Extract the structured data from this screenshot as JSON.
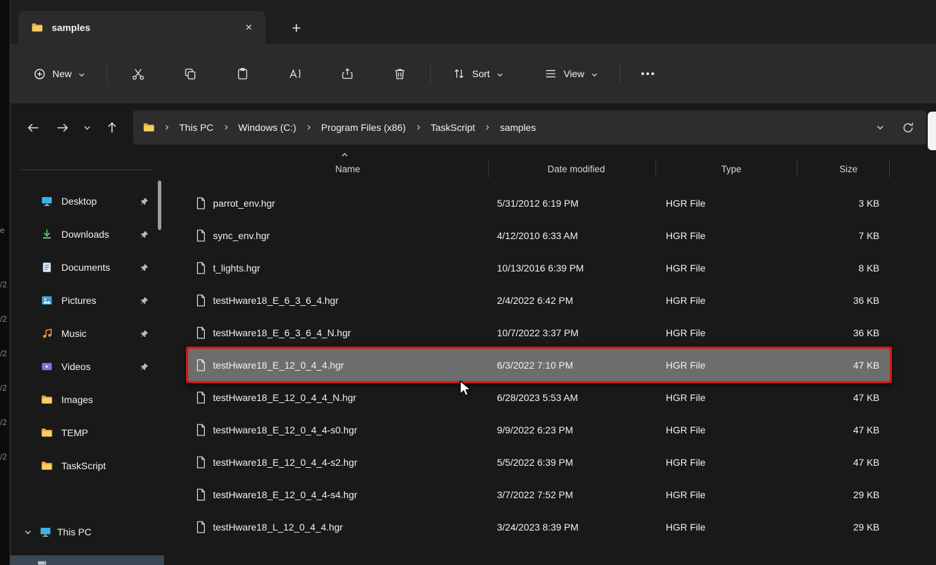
{
  "colors": {
    "annotation_red": "#e01515",
    "selection_gray": "#6d6d6d",
    "folder_yellow": "#f8ce63",
    "toolbar_gray": "#2b2b2b",
    "content_gray": "#191919"
  },
  "tab_bar": {
    "tab_title": "samples",
    "close_glyph": "×",
    "new_tab_glyph": "+"
  },
  "toolbar": {
    "new_label": "New",
    "sort_label": "Sort",
    "view_label": "View",
    "more_glyph": "•••"
  },
  "address": {
    "breadcrumb": [
      "This PC",
      "Windows (C:)",
      "Program Files (x86)",
      "TaskScript",
      "samples"
    ]
  },
  "sidebar": {
    "items": [
      {
        "label": "Desktop",
        "pinned": true
      },
      {
        "label": "Downloads",
        "pinned": true
      },
      {
        "label": "Documents",
        "pinned": true
      },
      {
        "label": "Pictures",
        "pinned": true
      },
      {
        "label": "Music",
        "pinned": true
      },
      {
        "label": "Videos",
        "pinned": true
      },
      {
        "label": "Images",
        "pinned": false
      },
      {
        "label": "TEMP",
        "pinned": false
      },
      {
        "label": "TaskScript",
        "pinned": false
      }
    ],
    "this_pc_label": "This PC"
  },
  "filelist": {
    "columns": [
      "Name",
      "Date modified",
      "Type",
      "Size"
    ],
    "sorted_by": "Name",
    "sort_direction": "ascending",
    "selected_index": 5,
    "rows": [
      {
        "name": "parrot_env.hgr",
        "date": "5/31/2012 6:19 PM",
        "type": "HGR File",
        "size": "3 KB"
      },
      {
        "name": "sync_env.hgr",
        "date": "4/12/2010 6:33 AM",
        "type": "HGR File",
        "size": "7 KB"
      },
      {
        "name": "t_lights.hgr",
        "date": "10/13/2016 6:39 PM",
        "type": "HGR File",
        "size": "8 KB"
      },
      {
        "name": "testHware18_E_6_3_6_4.hgr",
        "date": "2/4/2022 6:42 PM",
        "type": "HGR File",
        "size": "36 KB"
      },
      {
        "name": "testHware18_E_6_3_6_4_N.hgr",
        "date": "10/7/2022 3:37 PM",
        "type": "HGR File",
        "size": "36 KB"
      },
      {
        "name": "testHware18_E_12_0_4_4.hgr",
        "date": "6/3/2022 7:10 PM",
        "type": "HGR File",
        "size": "47 KB"
      },
      {
        "name": "testHware18_E_12_0_4_4_N.hgr",
        "date": "6/28/2023 5:53 AM",
        "type": "HGR File",
        "size": "47 KB"
      },
      {
        "name": "testHware18_E_12_0_4_4-s0.hgr",
        "date": "9/9/2022 6:23 PM",
        "type": "HGR File",
        "size": "47 KB"
      },
      {
        "name": "testHware18_E_12_0_4_4-s2.hgr",
        "date": "5/5/2022 6:39 PM",
        "type": "HGR File",
        "size": "47 KB"
      },
      {
        "name": "testHware18_E_12_0_4_4-s4.hgr",
        "date": "3/7/2022 7:52 PM",
        "type": "HGR File",
        "size": "29 KB"
      },
      {
        "name": "testHware18_L_12_0_4_4.hgr",
        "date": "3/24/2023 8:39 PM",
        "type": "HGR File",
        "size": "29 KB"
      }
    ]
  },
  "background_fragments": [
    "e",
    "/2",
    "/2",
    "/2",
    "/2",
    "/2",
    "/2"
  ]
}
